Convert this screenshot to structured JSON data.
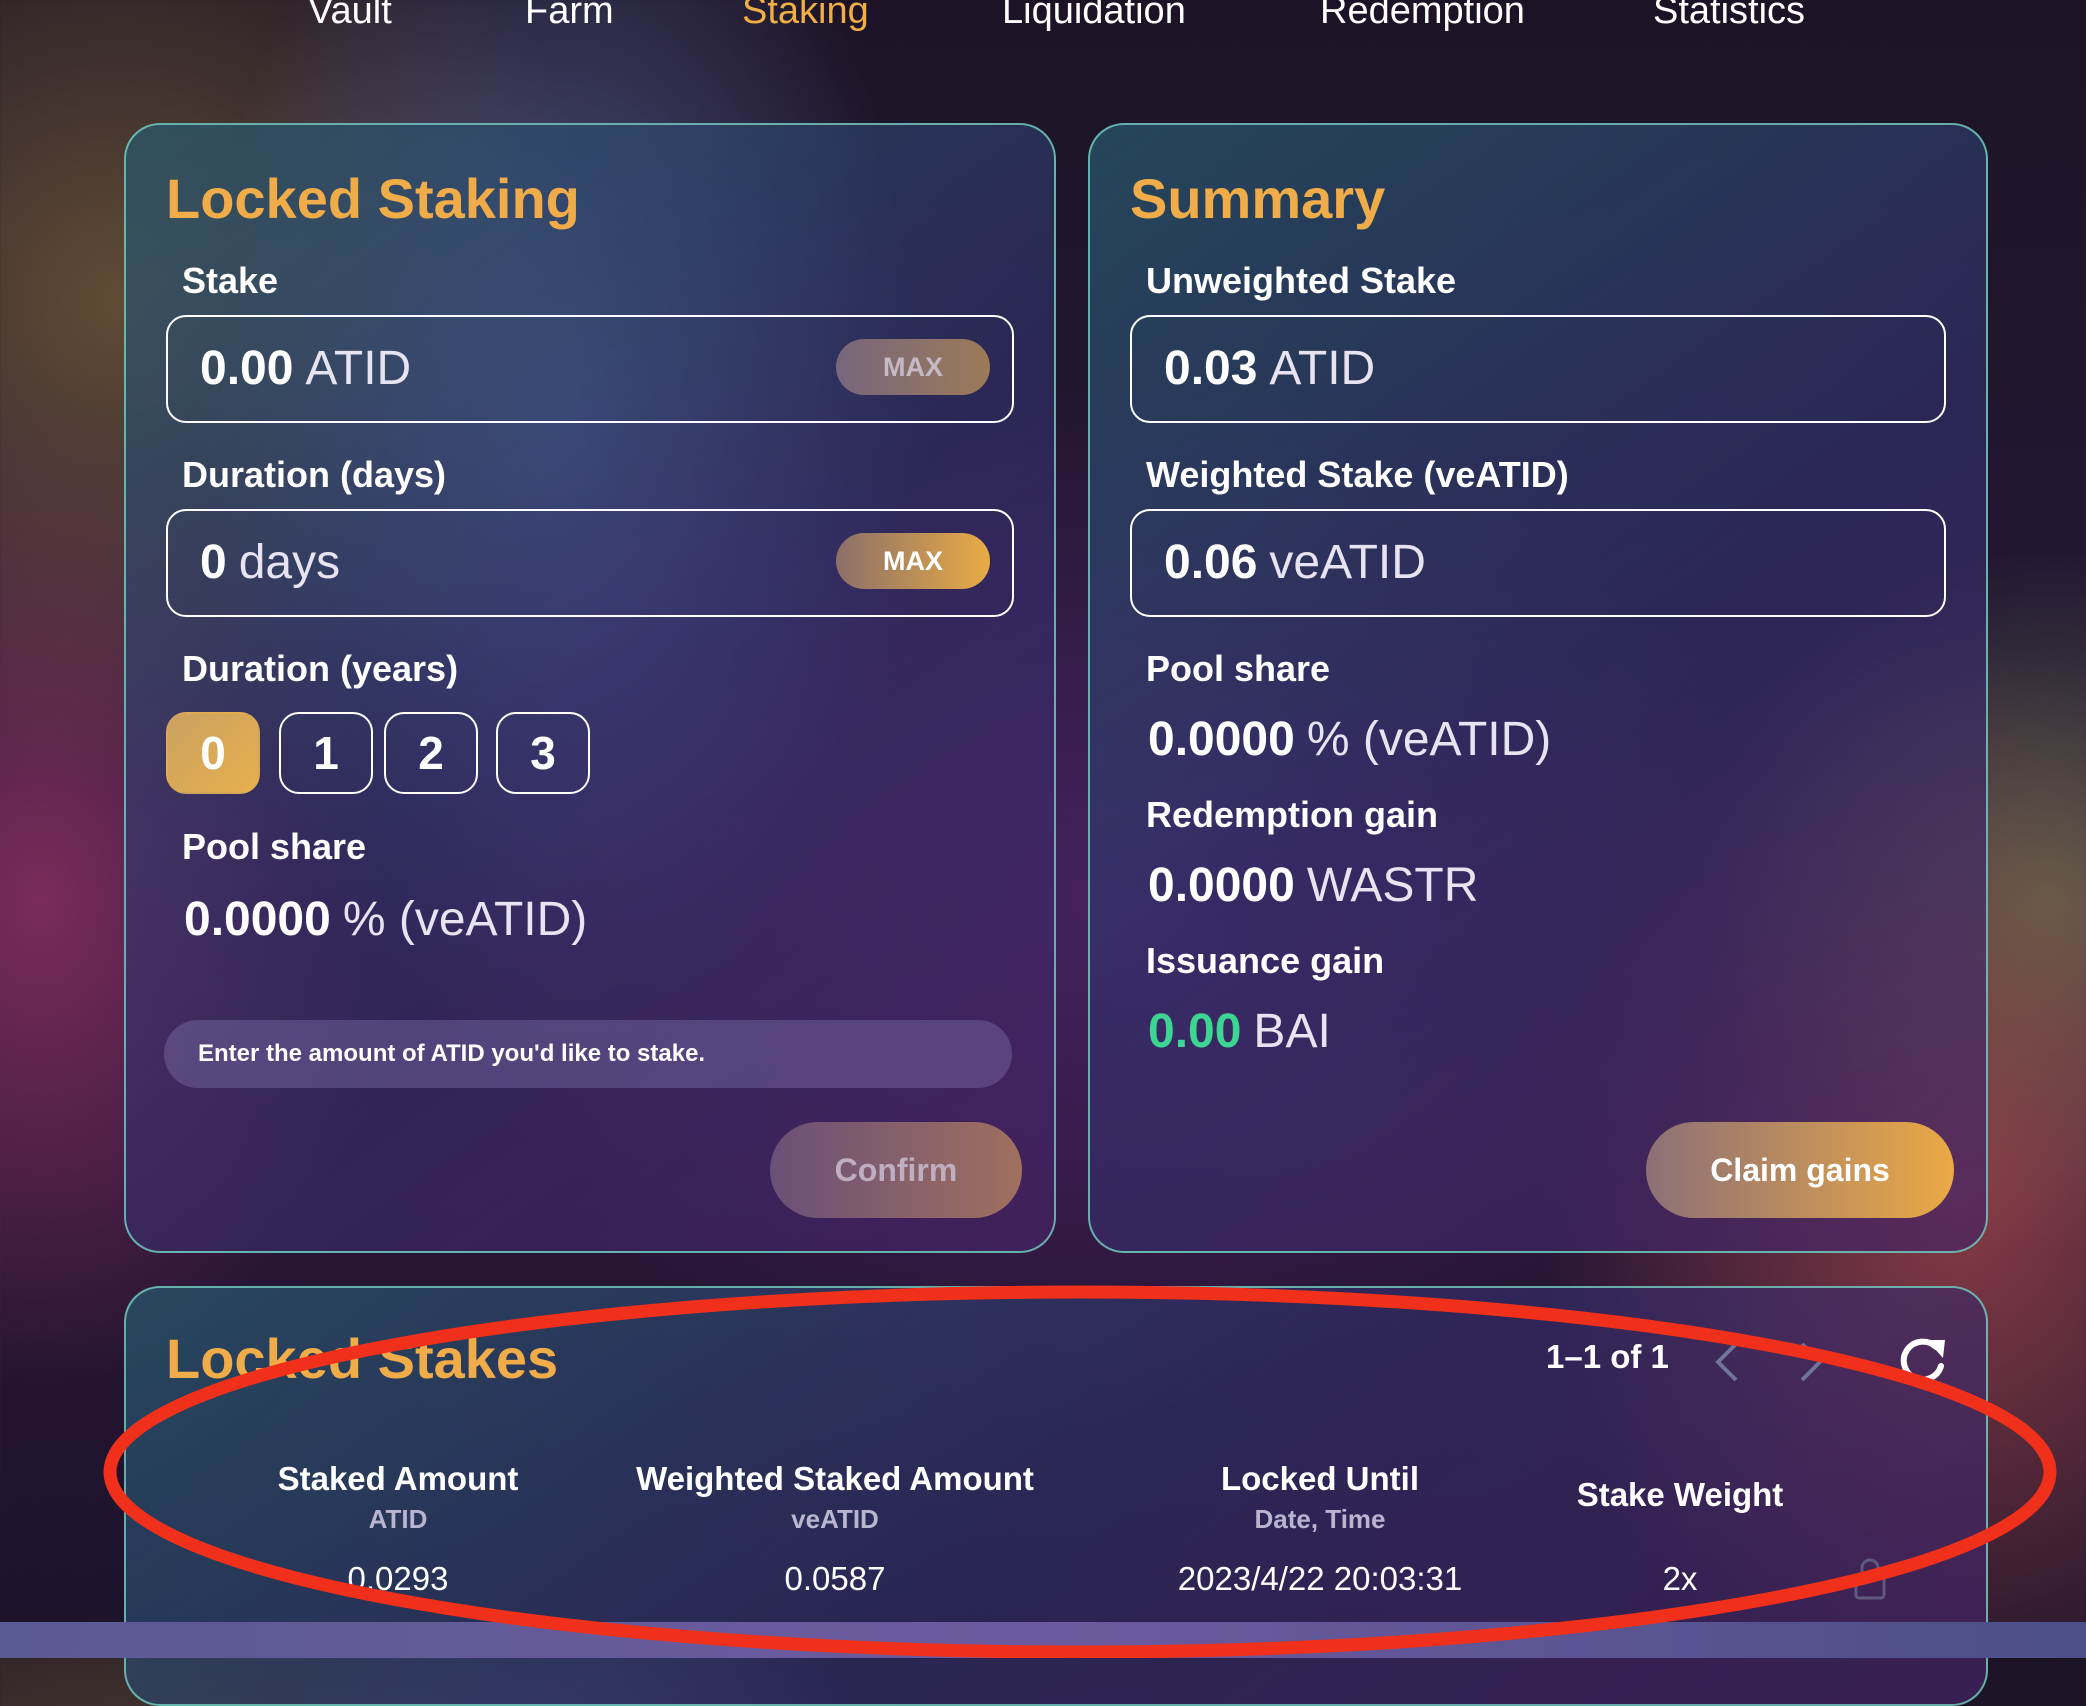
{
  "nav": {
    "items": [
      "Vault",
      "Farm",
      "Staking",
      "Liquidation",
      "Redemption",
      "Statistics"
    ],
    "active": "Staking"
  },
  "locked_staking": {
    "title": "Locked Staking",
    "stake_label": "Stake",
    "stake_value": "0.00",
    "stake_unit": "ATID",
    "max_label": "MAX",
    "duration_days_label": "Duration (days)",
    "duration_days_value": "0",
    "duration_days_unit": "days",
    "duration_years_label": "Duration (years)",
    "years": [
      "0",
      "1",
      "2",
      "3"
    ],
    "selected_year": "0",
    "pool_share_label": "Pool share",
    "pool_share_value": "0.0000",
    "pool_share_unit": "% (veATID)",
    "hint": "Enter the amount of ATID you'd like to stake.",
    "confirm_label": "Confirm"
  },
  "summary": {
    "title": "Summary",
    "unweighted_label": "Unweighted Stake",
    "unweighted_value": "0.03",
    "unweighted_unit": "ATID",
    "weighted_label": "Weighted Stake (veATID)",
    "weighted_value": "0.06",
    "weighted_unit": "veATID",
    "pool_share_label": "Pool share",
    "pool_share_value": "0.0000",
    "pool_share_unit": "% (veATID)",
    "redemption_label": "Redemption gain",
    "redemption_value": "0.0000",
    "redemption_unit": "WASTR",
    "issuance_label": "Issuance gain",
    "issuance_value": "0.00",
    "issuance_unit": "BAI",
    "claim_label": "Claim gains"
  },
  "locked_stakes": {
    "title": "Locked Stakes",
    "pagination": "1–1 of 1",
    "columns": [
      {
        "title": "Staked Amount",
        "sub": "ATID"
      },
      {
        "title": "Weighted Staked Amount",
        "sub": "veATID"
      },
      {
        "title": "Locked Until",
        "sub": "Date, Time"
      },
      {
        "title": "Stake Weight",
        "sub": ""
      }
    ],
    "rows": [
      {
        "staked": "0.0293",
        "weighted": "0.0587",
        "until": "2023/4/22 20:03:31",
        "weight": "2x"
      }
    ]
  },
  "colors": {
    "accent": "#efac48",
    "green": "#3cd592",
    "annotation_red": "#f0301a"
  }
}
